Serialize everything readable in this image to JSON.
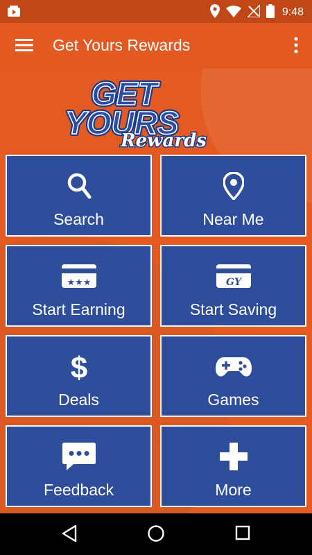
{
  "status": {
    "time": "9:48"
  },
  "appbar": {
    "title": "Get Yours Rewards"
  },
  "logo": {
    "line1": "GET",
    "line2": "YOURS",
    "line3": "Rewards"
  },
  "tiles": [
    {
      "label": "Search",
      "icon": "search-icon"
    },
    {
      "label": "Near Me",
      "icon": "location-pin-icon"
    },
    {
      "label": "Start Earning",
      "icon": "card-stars-icon"
    },
    {
      "label": "Start Saving",
      "icon": "gy-card-icon"
    },
    {
      "label": "Deals",
      "icon": "dollar-icon"
    },
    {
      "label": "Games",
      "icon": "gamepad-icon"
    },
    {
      "label": "Feedback",
      "icon": "chat-bubble-icon"
    },
    {
      "label": "More",
      "icon": "plus-icon"
    }
  ],
  "colors": {
    "accent": "#e25a22",
    "statusbar": "#c24716",
    "tile": "#2e4d9a"
  }
}
